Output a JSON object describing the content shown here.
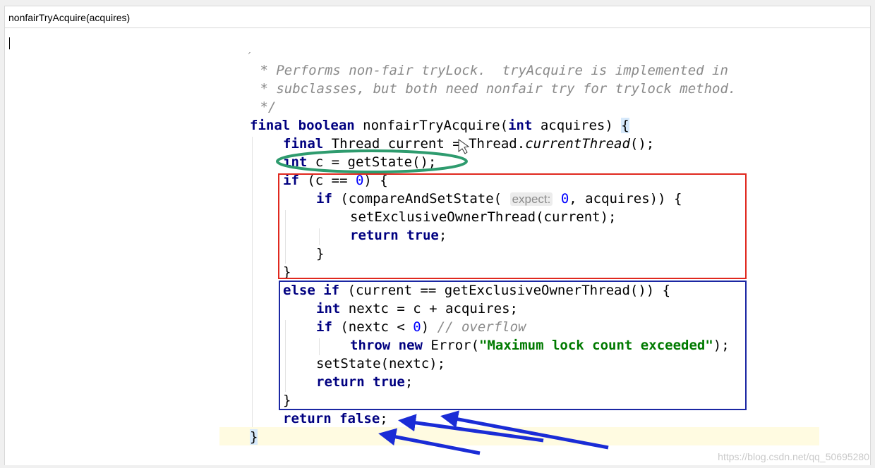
{
  "window": {
    "title": "nonfairTryAcquire(acquires)"
  },
  "code": {
    "comment_top": "´",
    "comment_1": " * Performs non-fair tryLock.  tryAcquire is implemented in",
    "comment_2": " * subclasses, but both need nonfair try for trylock method.",
    "comment_3": " */",
    "sig_kw": "final boolean ",
    "sig_name": "nonfairTryAcquire(",
    "sig_int": "int",
    "sig_param": " acquires) ",
    "sig_brace": "{",
    "l1_kw": "final ",
    "l1_rest": "Thread current = Thread.",
    "l1_method": "currentThread",
    "l1_end": "();",
    "l2_kw": "int",
    "l2_rest": " c = getState();",
    "l3_kw": "if",
    "l3_a": " (c == ",
    "l3_zero": "0",
    "l3_b": ") {",
    "l4_kw": "if",
    "l4_a": " (compareAndSetState( ",
    "l4_hint": "expect:",
    "l4_zero": " 0",
    "l4_b": ", acquires)) {",
    "l5": "setExclusiveOwnerThread(current);",
    "l6_kw": "return true",
    "l6_end": ";",
    "l7": "}",
    "l8": "}",
    "l9_kw": "else if",
    "l9_rest": " (current == getExclusiveOwnerThread()) {",
    "l10_kw": "int",
    "l10_rest": " nextc = c + acquires;",
    "l11_kw": "if",
    "l11_a": " (nextc < ",
    "l11_zero": "0",
    "l11_b": ") ",
    "l11_cm": "// overflow",
    "l12_kw": "throw new ",
    "l12_a": "Error(",
    "l12_str": "\"Maximum lock count exceeded\"",
    "l12_b": ");",
    "l13": "setState(nextc);",
    "l14_kw": "return true",
    "l14_end": ";",
    "l15": "}",
    "l16_kw": "return false",
    "l16_end": ";",
    "l17": "}"
  },
  "watermark": "https://blog.csdn.net/qq_50695280",
  "colors": {
    "annotation_green": "#2e9b6e",
    "annotation_red": "#e0281e",
    "annotation_blue_box": "#1b27a3",
    "annotation_arrow": "#1a2cd6"
  }
}
